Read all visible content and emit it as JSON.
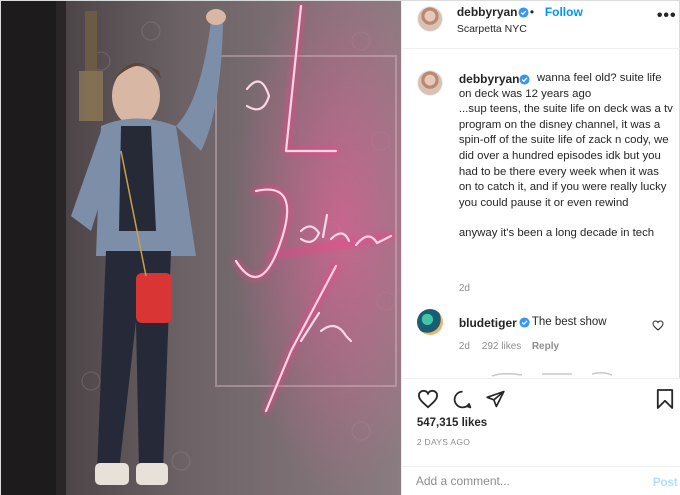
{
  "header": {
    "username": "debbyryan",
    "separator": "•",
    "follow_label": "Follow",
    "location": "Scarpetta NYC",
    "more_icon": "more-options-icon"
  },
  "photo": {
    "neon_text": [
      "La",
      "Dolce",
      "Vita"
    ],
    "neon_color": "#ff3b8a"
  },
  "caption": {
    "username": "debbyryan",
    "line1": "wanna feel old? suite life on deck was 12 years ago",
    "line2": "...sup teens, the suite life on deck was a tv program on the disney channel, it was a spin-off of the suite life of zack n cody, we did over a hundred episodes idk but you had to be there every week when it was on to catch it, and if you were really lucky you could pause it or even rewind",
    "line3": "anyway it's been a long decade in tech",
    "time": "2d"
  },
  "comment": {
    "username": "bludetiger",
    "text": "The best show",
    "time": "2d",
    "likes": "292 likes",
    "reply_label": "Reply"
  },
  "actions": {
    "likes": "547,315 likes",
    "posted": "2 DAYS AGO"
  },
  "add_comment": {
    "placeholder": "Add a comment...",
    "post_label": "Post"
  },
  "colors": {
    "accent": "#0095f6",
    "verified": "#3897f0",
    "muted": "#8e8e8e"
  }
}
